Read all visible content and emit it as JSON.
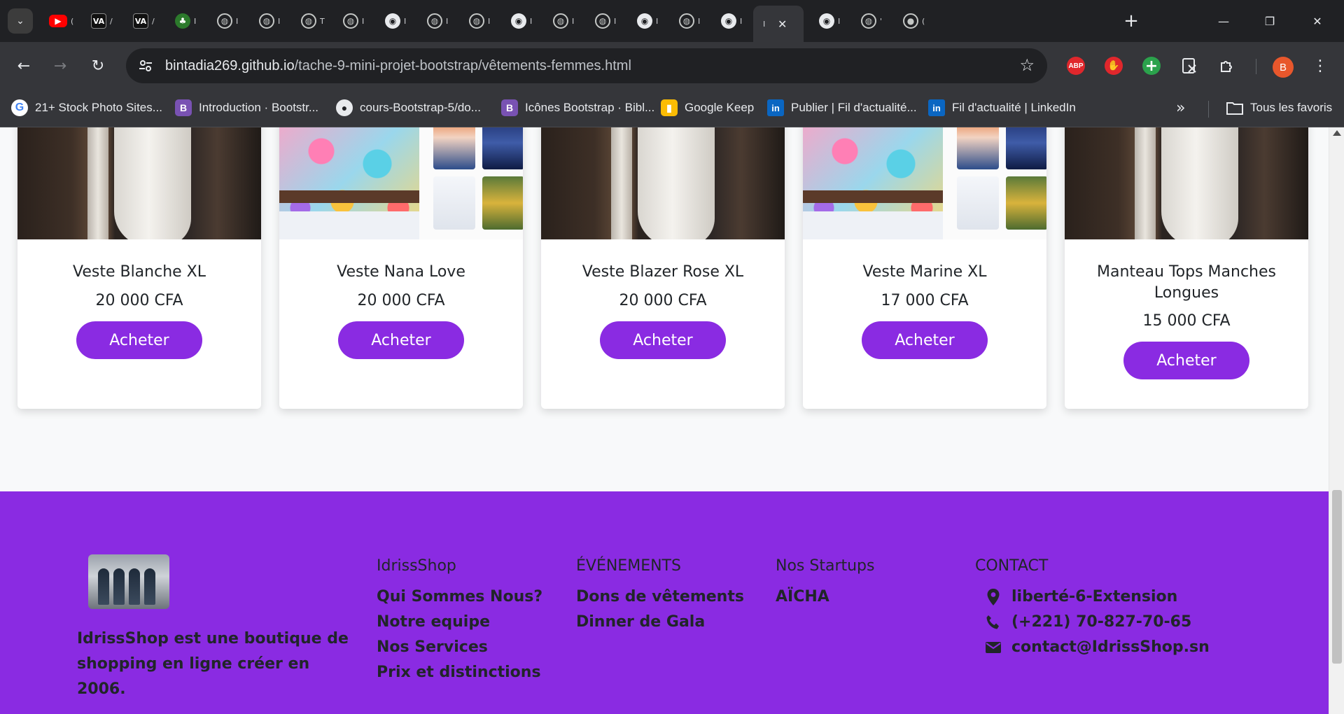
{
  "browser": {
    "tabs": [
      {
        "icon": "youtube-icon",
        "title": "("
      },
      {
        "icon": "va-icon",
        "title": "/"
      },
      {
        "icon": "va-icon",
        "title": "/"
      },
      {
        "icon": "sm-icon",
        "title": "I"
      },
      {
        "icon": "globe-icon",
        "title": "I"
      },
      {
        "icon": "globe-icon",
        "title": "I"
      },
      {
        "icon": "globe-icon",
        "title": "T"
      },
      {
        "icon": "globe-icon",
        "title": "I"
      },
      {
        "icon": "github-icon",
        "title": "I"
      },
      {
        "icon": "globe-icon",
        "title": "I"
      },
      {
        "icon": "globe-icon",
        "title": "I"
      },
      {
        "icon": "github-icon",
        "title": "I"
      },
      {
        "icon": "globe-icon",
        "title": "I"
      },
      {
        "icon": "globe-icon",
        "title": "I"
      },
      {
        "icon": "github-icon",
        "title": "I"
      },
      {
        "icon": "globe-icon",
        "title": "I"
      },
      {
        "icon": "github-icon",
        "title": "I"
      }
    ],
    "active_tab_title": "I",
    "after_tabs": [
      {
        "icon": "github-icon",
        "title": "I"
      },
      {
        "icon": "globe-icon",
        "title": "'"
      },
      {
        "icon": "notification-icon",
        "title": "("
      }
    ],
    "url_host": "bintadia269.github.io",
    "url_path": "/tache-9-mini-projet-bootstrap/vêtements-femmes.html",
    "abp_label": "ABP",
    "avatar_letter": "B",
    "bookmarks": [
      {
        "icon": "google-icon",
        "glyph": "G",
        "label": "21+ Stock Photo Sites..."
      },
      {
        "icon": "bootstrap-icon",
        "glyph": "B",
        "label": "Introduction · Bootstr..."
      },
      {
        "icon": "github-icon",
        "glyph": "●",
        "label": "cours-Bootstrap-5/do..."
      },
      {
        "icon": "bootstrap-icon",
        "glyph": "B",
        "label": "Icônes Bootstrap · Bibl..."
      },
      {
        "icon": "keep-icon",
        "glyph": "▮",
        "label": "Google Keep"
      },
      {
        "icon": "linkedin-icon",
        "glyph": "in",
        "label": "Publier | Fil d'actualité..."
      },
      {
        "icon": "linkedin-icon",
        "glyph": "in",
        "label": "Fil d'actualité | LinkedIn"
      }
    ],
    "all_bookmarks_label": "Tous les favoris"
  },
  "products": [
    {
      "name": "Veste Blanche XL",
      "price": "20 000 CFA",
      "button": "Acheter",
      "image": "skirt"
    },
    {
      "name": "Veste Nana Love",
      "price": "20 000 CFA",
      "button": "Acheter",
      "image": "tops"
    },
    {
      "name": "Veste Blazer Rose XL",
      "price": "20 000 CFA",
      "button": "Acheter",
      "image": "skirt"
    },
    {
      "name": "Veste Marine XL",
      "price": "17 000 CFA",
      "button": "Acheter",
      "image": "tops"
    },
    {
      "name": "Manteau Tops Manches Longues",
      "price": "15 000 CFA",
      "button": "Acheter",
      "image": "skirt"
    }
  ],
  "footer": {
    "about": "IdrissShop est une boutique de shopping en ligne créer en 2006.",
    "columns": [
      {
        "heading": "IdrissShop",
        "links": [
          "Qui Sommes Nous?",
          "Notre equipe",
          "Nos Services",
          "Prix et distinctions"
        ]
      },
      {
        "heading": "ÉVÉNEMENTS",
        "links": [
          "Dons de vêtements",
          "Dinner de Gala"
        ]
      },
      {
        "heading": "Nos Startups",
        "links": [
          "AÏCHA"
        ]
      }
    ],
    "contact": {
      "heading": "CONTACT",
      "address": "liberté-6-Extension",
      "phone": " (+221) 70-827-70-65",
      "email": "contact@IdrissShop.sn"
    }
  },
  "colors": {
    "brand_purple": "#8a2be2",
    "chrome_dark": "#202124",
    "chrome_toolbar": "#35363a"
  }
}
